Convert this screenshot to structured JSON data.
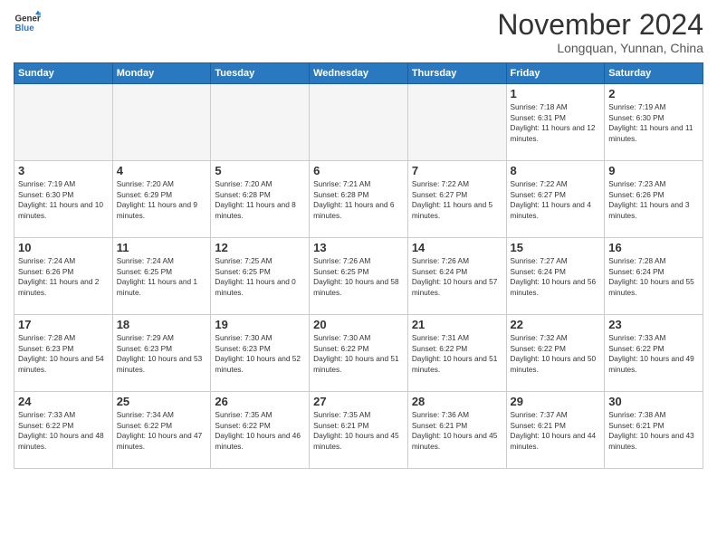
{
  "header": {
    "logo_line1": "General",
    "logo_line2": "Blue",
    "month": "November 2024",
    "location": "Longquan, Yunnan, China"
  },
  "weekdays": [
    "Sunday",
    "Monday",
    "Tuesday",
    "Wednesday",
    "Thursday",
    "Friday",
    "Saturday"
  ],
  "weeks": [
    [
      {
        "day": "",
        "info": ""
      },
      {
        "day": "",
        "info": ""
      },
      {
        "day": "",
        "info": ""
      },
      {
        "day": "",
        "info": ""
      },
      {
        "day": "",
        "info": ""
      },
      {
        "day": "1",
        "info": "Sunrise: 7:18 AM\nSunset: 6:31 PM\nDaylight: 11 hours and 12 minutes."
      },
      {
        "day": "2",
        "info": "Sunrise: 7:19 AM\nSunset: 6:30 PM\nDaylight: 11 hours and 11 minutes."
      }
    ],
    [
      {
        "day": "3",
        "info": "Sunrise: 7:19 AM\nSunset: 6:30 PM\nDaylight: 11 hours and 10 minutes."
      },
      {
        "day": "4",
        "info": "Sunrise: 7:20 AM\nSunset: 6:29 PM\nDaylight: 11 hours and 9 minutes."
      },
      {
        "day": "5",
        "info": "Sunrise: 7:20 AM\nSunset: 6:28 PM\nDaylight: 11 hours and 8 minutes."
      },
      {
        "day": "6",
        "info": "Sunrise: 7:21 AM\nSunset: 6:28 PM\nDaylight: 11 hours and 6 minutes."
      },
      {
        "day": "7",
        "info": "Sunrise: 7:22 AM\nSunset: 6:27 PM\nDaylight: 11 hours and 5 minutes."
      },
      {
        "day": "8",
        "info": "Sunrise: 7:22 AM\nSunset: 6:27 PM\nDaylight: 11 hours and 4 minutes."
      },
      {
        "day": "9",
        "info": "Sunrise: 7:23 AM\nSunset: 6:26 PM\nDaylight: 11 hours and 3 minutes."
      }
    ],
    [
      {
        "day": "10",
        "info": "Sunrise: 7:24 AM\nSunset: 6:26 PM\nDaylight: 11 hours and 2 minutes."
      },
      {
        "day": "11",
        "info": "Sunrise: 7:24 AM\nSunset: 6:25 PM\nDaylight: 11 hours and 1 minute."
      },
      {
        "day": "12",
        "info": "Sunrise: 7:25 AM\nSunset: 6:25 PM\nDaylight: 11 hours and 0 minutes."
      },
      {
        "day": "13",
        "info": "Sunrise: 7:26 AM\nSunset: 6:25 PM\nDaylight: 10 hours and 58 minutes."
      },
      {
        "day": "14",
        "info": "Sunrise: 7:26 AM\nSunset: 6:24 PM\nDaylight: 10 hours and 57 minutes."
      },
      {
        "day": "15",
        "info": "Sunrise: 7:27 AM\nSunset: 6:24 PM\nDaylight: 10 hours and 56 minutes."
      },
      {
        "day": "16",
        "info": "Sunrise: 7:28 AM\nSunset: 6:24 PM\nDaylight: 10 hours and 55 minutes."
      }
    ],
    [
      {
        "day": "17",
        "info": "Sunrise: 7:28 AM\nSunset: 6:23 PM\nDaylight: 10 hours and 54 minutes."
      },
      {
        "day": "18",
        "info": "Sunrise: 7:29 AM\nSunset: 6:23 PM\nDaylight: 10 hours and 53 minutes."
      },
      {
        "day": "19",
        "info": "Sunrise: 7:30 AM\nSunset: 6:23 PM\nDaylight: 10 hours and 52 minutes."
      },
      {
        "day": "20",
        "info": "Sunrise: 7:30 AM\nSunset: 6:22 PM\nDaylight: 10 hours and 51 minutes."
      },
      {
        "day": "21",
        "info": "Sunrise: 7:31 AM\nSunset: 6:22 PM\nDaylight: 10 hours and 51 minutes."
      },
      {
        "day": "22",
        "info": "Sunrise: 7:32 AM\nSunset: 6:22 PM\nDaylight: 10 hours and 50 minutes."
      },
      {
        "day": "23",
        "info": "Sunrise: 7:33 AM\nSunset: 6:22 PM\nDaylight: 10 hours and 49 minutes."
      }
    ],
    [
      {
        "day": "24",
        "info": "Sunrise: 7:33 AM\nSunset: 6:22 PM\nDaylight: 10 hours and 48 minutes."
      },
      {
        "day": "25",
        "info": "Sunrise: 7:34 AM\nSunset: 6:22 PM\nDaylight: 10 hours and 47 minutes."
      },
      {
        "day": "26",
        "info": "Sunrise: 7:35 AM\nSunset: 6:22 PM\nDaylight: 10 hours and 46 minutes."
      },
      {
        "day": "27",
        "info": "Sunrise: 7:35 AM\nSunset: 6:21 PM\nDaylight: 10 hours and 45 minutes."
      },
      {
        "day": "28",
        "info": "Sunrise: 7:36 AM\nSunset: 6:21 PM\nDaylight: 10 hours and 45 minutes."
      },
      {
        "day": "29",
        "info": "Sunrise: 7:37 AM\nSunset: 6:21 PM\nDaylight: 10 hours and 44 minutes."
      },
      {
        "day": "30",
        "info": "Sunrise: 7:38 AM\nSunset: 6:21 PM\nDaylight: 10 hours and 43 minutes."
      }
    ]
  ]
}
